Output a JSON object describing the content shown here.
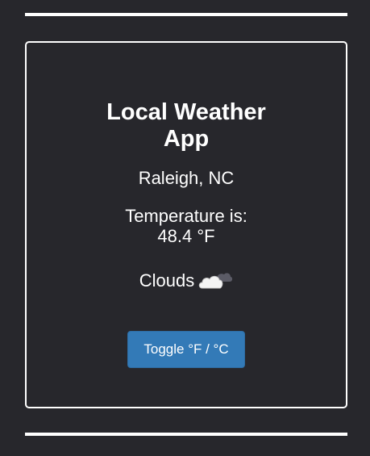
{
  "app": {
    "title_line1": "Local Weather",
    "title_line2": "App"
  },
  "weather": {
    "location": "Raleigh, NC",
    "temperature_label": "Temperature is:",
    "temperature_value": "48.4 °F",
    "condition": "Clouds",
    "condition_icon": "cloud-moon-icon"
  },
  "controls": {
    "toggle_label": "Toggle °F / °C"
  },
  "colors": {
    "background": "#27272c",
    "button": "#337ab7",
    "text": "#ffffff"
  }
}
